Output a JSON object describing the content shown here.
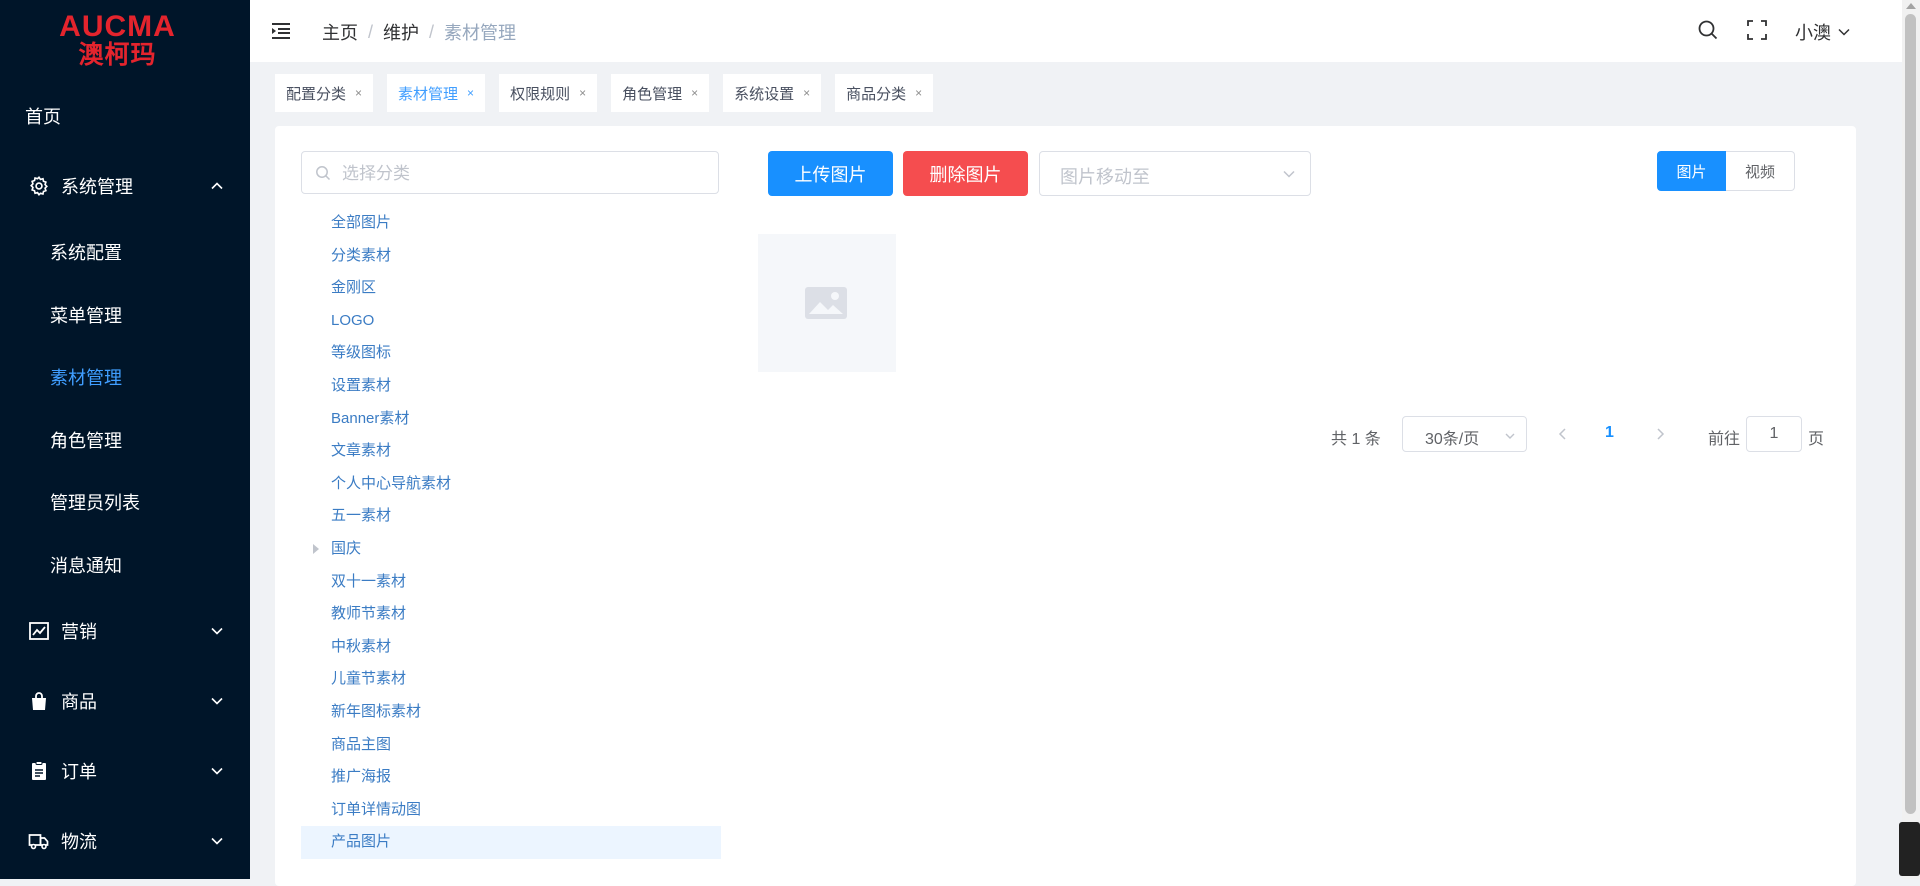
{
  "brand": {
    "name_en": "AUCMA",
    "name_cn": "澳柯玛",
    "color": "#e4242d"
  },
  "sidebar": {
    "background": "#001529",
    "active_color": "#409eff",
    "home": "首页",
    "system": {
      "label": "系统管理",
      "icon": "gear-icon",
      "expanded": true
    },
    "system_children": [
      "系统配置",
      "菜单管理",
      "素材管理",
      "角色管理",
      "管理员列表",
      "消息通知"
    ],
    "active_child": "素材管理",
    "groups": [
      {
        "label": "营销",
        "icon": "chart-icon"
      },
      {
        "label": "商品",
        "icon": "shopping-bag-icon"
      },
      {
        "label": "订单",
        "icon": "clipboard-icon"
      },
      {
        "label": "物流",
        "icon": "truck-icon"
      }
    ]
  },
  "header": {
    "breadcrumb": [
      "主页",
      "维护",
      "素材管理"
    ],
    "separator": "/",
    "user": "小澳"
  },
  "tags": [
    {
      "label": "配置分类",
      "active": false
    },
    {
      "label": "素材管理",
      "active": true
    },
    {
      "label": "权限规则",
      "active": false
    },
    {
      "label": "角色管理",
      "active": false
    },
    {
      "label": "系统设置",
      "active": false
    },
    {
      "label": "商品分类",
      "active": false
    }
  ],
  "tag_close": "×",
  "category": {
    "placeholder": "选择分类",
    "items": [
      {
        "label": "全部图片"
      },
      {
        "label": "分类素材"
      },
      {
        "label": "金刚区"
      },
      {
        "label": "LOGO"
      },
      {
        "label": "等级图标"
      },
      {
        "label": "设置素材"
      },
      {
        "label": "Banner素材"
      },
      {
        "label": "文章素材"
      },
      {
        "label": "个人中心导航素材"
      },
      {
        "label": "五一素材"
      },
      {
        "label": "国庆",
        "has_children": true
      },
      {
        "label": "双十一素材"
      },
      {
        "label": "教师节素材"
      },
      {
        "label": "中秋素材"
      },
      {
        "label": "儿童节素材"
      },
      {
        "label": "新年图标素材"
      },
      {
        "label": "商品主图"
      },
      {
        "label": "推广海报"
      },
      {
        "label": "订单详情动图"
      },
      {
        "label": "产品图片",
        "selected": true
      }
    ]
  },
  "toolbar": {
    "upload_label": "上传图片",
    "delete_label": "删除图片",
    "move_placeholder": "图片移动至",
    "upload_color": "#1890ff",
    "delete_color": "#f54d4f"
  },
  "media_type": {
    "options": [
      "图片",
      "视频"
    ],
    "selected": "图片"
  },
  "gallery": {
    "items": [
      {
        "icon": "image-placeholder-icon"
      }
    ]
  },
  "pagination": {
    "total_text": "共 1 条",
    "page_size": "30条/页",
    "current_page": "1",
    "goto_label": "前往",
    "goto_value": "1",
    "page_suffix": "页"
  }
}
